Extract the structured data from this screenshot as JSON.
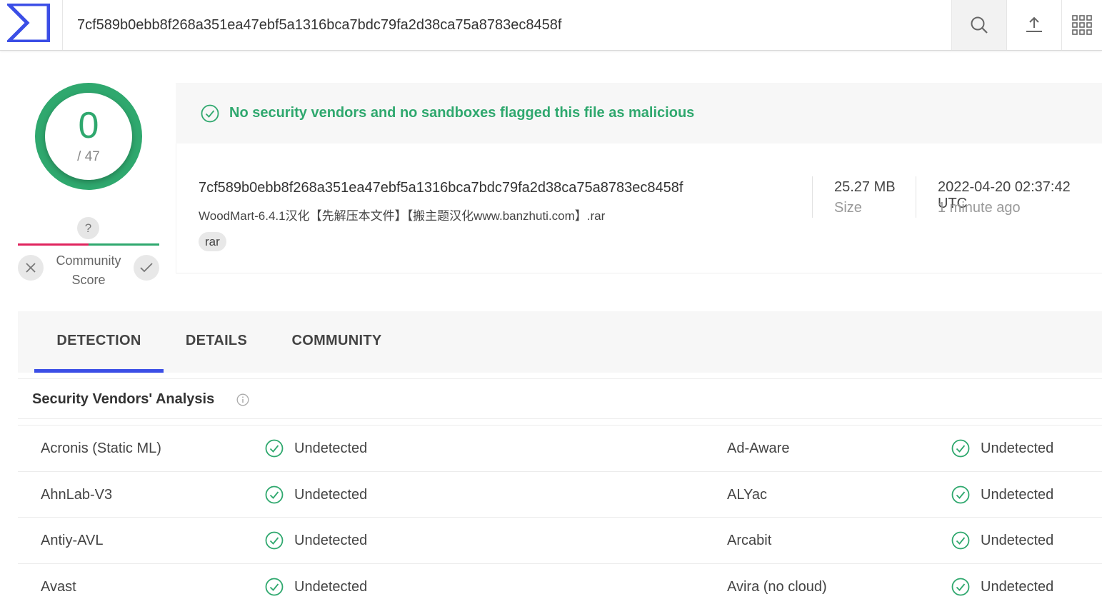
{
  "header": {
    "search_value": "7cf589b0ebb8f268a351ea47ebf5a1316bca7bdc79fa2d38ca75a8783ec8458f",
    "logo_icon": "sigma-logo-icon",
    "buttons": [
      "search-icon",
      "upload-icon",
      "apps-grid-icon"
    ]
  },
  "score": {
    "detections": "0",
    "total": "/ 47",
    "color": "#2fa86e"
  },
  "community": {
    "unknown_glyph": "?",
    "label_line1": "Community",
    "label_line2": "Score"
  },
  "banner": {
    "text": "No security vendors and no sandboxes flagged this file as malicious"
  },
  "file": {
    "hash": "7cf589b0ebb8f268a351ea47ebf5a1316bca7bdc79fa2d38ca75a8783ec8458f",
    "name": "WoodMart-6.4.1汉化【先解压本文件】【搬主题汉化www.banzhuti.com】.rar",
    "tag": "rar",
    "size_value": "25.27 MB",
    "size_label": "Size",
    "date_value": "2022-04-20 02:37:42 UTC",
    "date_label": "1 minute ago"
  },
  "tabs": [
    {
      "label": "DETECTION",
      "active": true
    },
    {
      "label": "DETAILS",
      "active": false
    },
    {
      "label": "COMMUNITY",
      "active": false
    }
  ],
  "analysis": {
    "title": "Security Vendors' Analysis",
    "rows": [
      {
        "left_vendor": "Acronis (Static ML)",
        "left_result": "Undetected",
        "right_vendor": "Ad-Aware",
        "right_result": "Undetected"
      },
      {
        "left_vendor": "AhnLab-V3",
        "left_result": "Undetected",
        "right_vendor": "ALYac",
        "right_result": "Undetected"
      },
      {
        "left_vendor": "Antiy-AVL",
        "left_result": "Undetected",
        "right_vendor": "Arcabit",
        "right_result": "Undetected"
      },
      {
        "left_vendor": "Avast",
        "left_result": "Undetected",
        "right_vendor": "Avira (no cloud)",
        "right_result": "Undetected"
      }
    ]
  },
  "colors": {
    "accent": "#3b4ee6",
    "clean": "#2fa86e",
    "negative": "#e0245e"
  }
}
